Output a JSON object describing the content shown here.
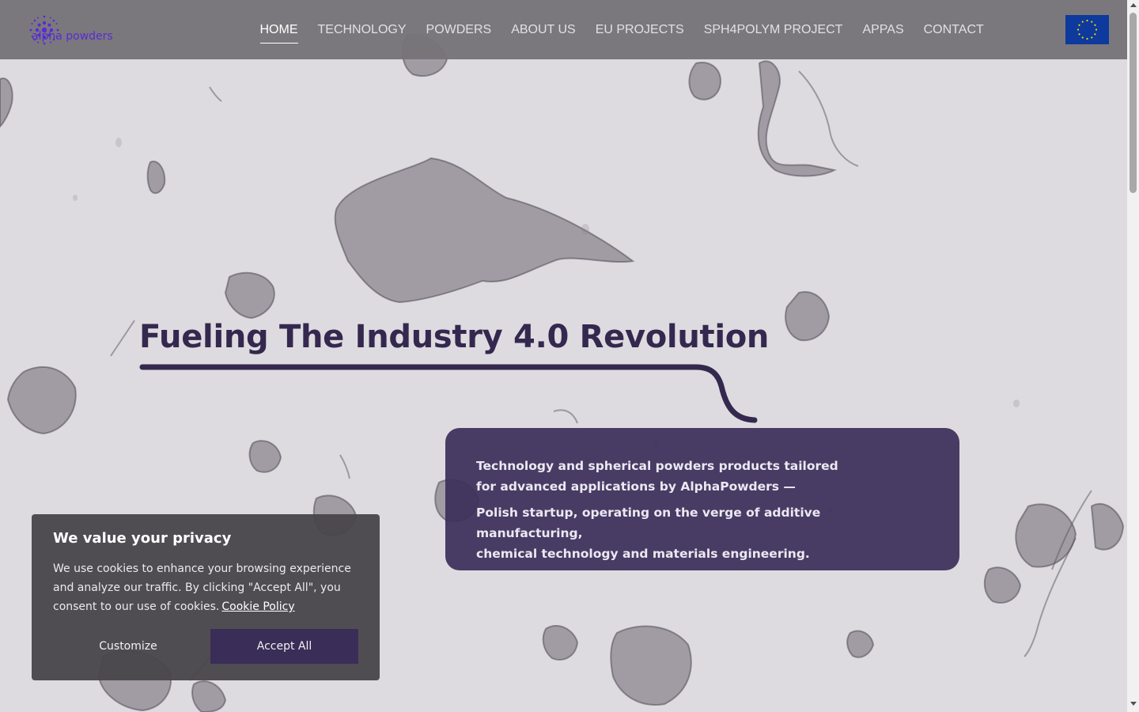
{
  "header": {
    "logo_text": "alpha powders",
    "nav": [
      {
        "label": "HOME",
        "active": true
      },
      {
        "label": "TECHNOLOGY",
        "active": false
      },
      {
        "label": "POWDERS",
        "active": false
      },
      {
        "label": "ABOUT US",
        "active": false
      },
      {
        "label": "EU PROJECTS",
        "active": false
      },
      {
        "label": "SPH4POLYM PROJECT",
        "active": false
      },
      {
        "label": "APPAS",
        "active": false
      },
      {
        "label": "CONTACT",
        "active": false
      }
    ],
    "flag_icon": "eu-flag-icon"
  },
  "hero": {
    "title": "Fueling The Industry 4.0 Revolution",
    "description_line1": "Technology and spherical powders products tailored",
    "description_line2": "for advanced applications by AlphaPowders —",
    "description_line3": "Polish startup, operating on the verge of additive manufacturing,",
    "description_line4": "chemical technology and materials engineering."
  },
  "cookie_banner": {
    "title": "We value your privacy",
    "text": "We use cookies to enhance your browsing experience and analyze our traffic. By clicking \"Accept All\", you consent to our use of cookies.",
    "policy_link": "Cookie Policy",
    "customize_label": "Customize",
    "accept_label": "Accept All"
  },
  "colors": {
    "brand": "#5a2bd6",
    "title": "#35284f",
    "info_box": "#3c2f5a",
    "accept_button": "#3a2d57",
    "eu_blue": "#0d3a9c",
    "eu_star": "#ffd700"
  }
}
